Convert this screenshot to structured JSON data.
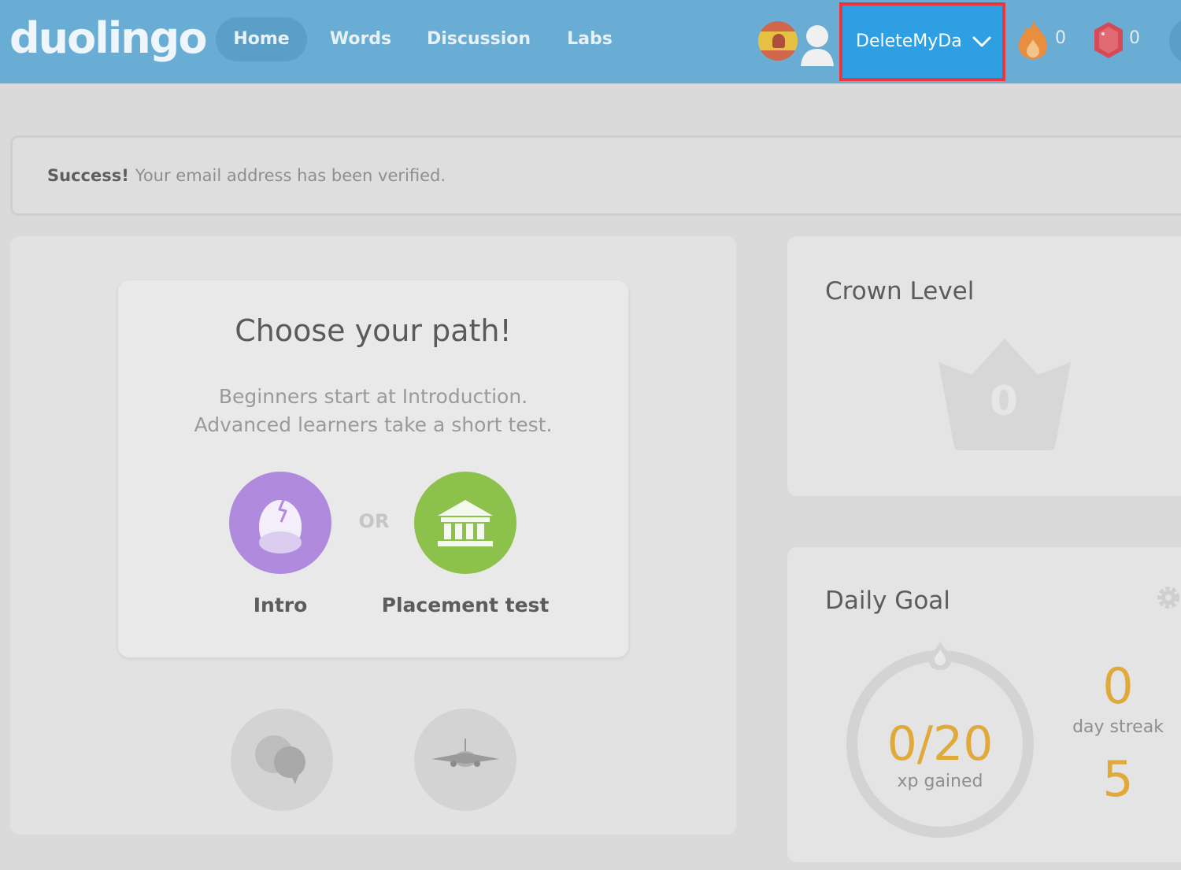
{
  "header": {
    "logo": "duolingo",
    "nav": {
      "home": "Home",
      "words": "Words",
      "discussion": "Discussion",
      "labs": "Labs"
    },
    "flag_icon": "spain-flag-icon",
    "avatar_icon": "user-avatar-icon",
    "username": "DeleteMyDa",
    "dropdown_icon": "chevron-down-icon",
    "streak_icon": "flame-icon",
    "streak_count": "0",
    "gems_icon": "gem-icon",
    "gems_count": "0",
    "highlight_color": "#e8373d",
    "accent_color": "#2e9fe3"
  },
  "banner": {
    "strong": "Success!",
    "message": "Your email address has been verified."
  },
  "path": {
    "title": "Choose your path!",
    "desc_line1": "Beginners start at Introduction.",
    "desc_line2": "Advanced learners take a short test.",
    "or": "OR",
    "intro_label": "Intro",
    "intro_icon": "egg-icon",
    "intro_color": "#b08bdd",
    "placement_label": "Placement test",
    "placement_icon": "building-icon",
    "placement_color": "#8cc24c",
    "skills": [
      {
        "icon": "chat-bubbles-icon"
      },
      {
        "icon": "airplane-icon"
      }
    ]
  },
  "crown": {
    "title": "Crown Level",
    "level": "0",
    "icon": "crown-icon"
  },
  "goal": {
    "title": "Daily Goal",
    "settings_icon": "gear-icon",
    "xp": "0/20",
    "xp_label": "xp gained",
    "streak_value": "0",
    "streak_label": "day streak",
    "next_value": "5",
    "accent_color": "#e0aa3a"
  }
}
